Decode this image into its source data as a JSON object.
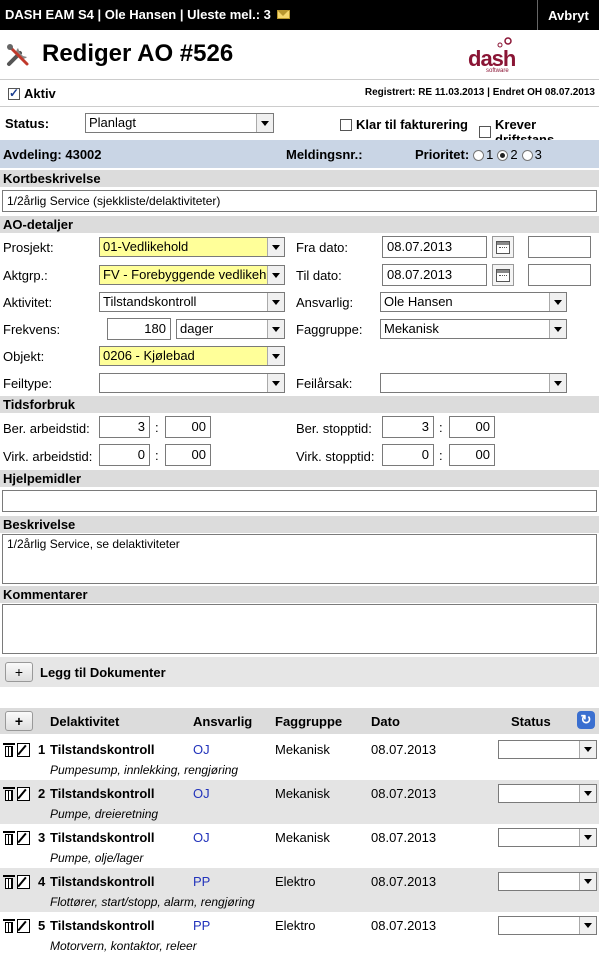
{
  "topbar": {
    "title": "DASH EAM S4 | Ole Hansen | Uleste mel.: 3",
    "cancel": "Avbryt"
  },
  "page": {
    "title": "Rediger AO #526",
    "logo_text": "dash",
    "logo_sub": "software"
  },
  "aktiv": {
    "label": "Aktiv",
    "checked": true
  },
  "registrert": "Registrert: RE 11.03.2013 | Endret OH 08.07.2013",
  "status": {
    "label": "Status:",
    "value": "Planlagt"
  },
  "klar": {
    "label": "Klar til fakturering",
    "checked": false
  },
  "krever": {
    "label": "Krever driftstans",
    "checked": false
  },
  "avdeling": "Avdeling: 43002",
  "meldingsnr": "Meldingsnr.:",
  "prioritet": {
    "label": "Prioritet:",
    "options": [
      "1",
      "2",
      "3"
    ],
    "selected": "2"
  },
  "kortbeskrivelse": {
    "label": "Kortbeskrivelse",
    "value": "1/2årlig Service (sjekkliste/delaktiviteter)"
  },
  "ao_detaljer": {
    "label": "AO-detaljer",
    "prosjekt": {
      "label": "Prosjekt:",
      "value": "01-Vedlikehold"
    },
    "aktgrp": {
      "label": "Aktgrp.:",
      "value": "FV - Forebyggende vedlikeh"
    },
    "aktivitet": {
      "label": "Aktivitet:",
      "value": "Tilstandskontroll"
    },
    "frekvens": {
      "label": "Frekvens:",
      "value": "180",
      "unit": "dager"
    },
    "objekt": {
      "label": "Objekt:",
      "value": "0206 - Kjølebad"
    },
    "feiltype": {
      "label": "Feiltype:",
      "value": ""
    },
    "fra_dato": {
      "label": "Fra dato:",
      "value": "08.07.2013",
      "time": ""
    },
    "til_dato": {
      "label": "Til dato:",
      "value": "08.07.2013",
      "time": ""
    },
    "ansvarlig": {
      "label": "Ansvarlig:",
      "value": "Ole Hansen"
    },
    "faggruppe": {
      "label": "Faggruppe:",
      "value": "Mekanisk"
    },
    "feilarsak": {
      "label": "Feilårsak:",
      "value": ""
    }
  },
  "tidsforbruk": {
    "label": "Tidsforbruk",
    "ber_arbeid": {
      "label": "Ber. arbeidstid:",
      "h": "3",
      "m": "00"
    },
    "virk_arbeid": {
      "label": "Virk. arbeidstid:",
      "h": "0",
      "m": "00"
    },
    "ber_stopp": {
      "label": "Ber. stopptid:",
      "h": "3",
      "m": "00"
    },
    "virk_stopp": {
      "label": "Virk. stopptid:",
      "h": "0",
      "m": "00"
    },
    "sep": ":"
  },
  "hjelpemidler": {
    "label": "Hjelpemidler",
    "value": ""
  },
  "beskrivelse": {
    "label": "Beskrivelse",
    "value": "1/2årlig Service, se delaktiviteter"
  },
  "kommentarer": {
    "label": "Kommentarer",
    "value": ""
  },
  "dokumenter": {
    "plus": "+",
    "label": "Legg til Dokumenter"
  },
  "table": {
    "plus": "+",
    "headers": {
      "delaktivitet": "Delaktivitet",
      "ansvarlig": "Ansvarlig",
      "faggruppe": "Faggruppe",
      "dato": "Dato",
      "status": "Status"
    },
    "rows": [
      {
        "num": "1",
        "name": "Tilstandskontroll",
        "desc": "Pumpesump, innlekking, rengjøring",
        "ans": "OJ",
        "fag": "Mekanisk",
        "dato": "08.07.2013",
        "status": ""
      },
      {
        "num": "2",
        "name": "Tilstandskontroll",
        "desc": "Pumpe, dreieretning",
        "ans": "OJ",
        "fag": "Mekanisk",
        "dato": "08.07.2013",
        "status": ""
      },
      {
        "num": "3",
        "name": "Tilstandskontroll",
        "desc": "Pumpe, olje/lager",
        "ans": "OJ",
        "fag": "Mekanisk",
        "dato": "08.07.2013",
        "status": ""
      },
      {
        "num": "4",
        "name": "Tilstandskontroll",
        "desc": "Flottører, start/stopp, alarm, rengjøring",
        "ans": "PP",
        "fag": "Elektro",
        "dato": "08.07.2013",
        "status": ""
      },
      {
        "num": "5",
        "name": "Tilstandskontroll",
        "desc": "Motorvern, kontaktor, releer",
        "ans": "PP",
        "fag": "Elektro",
        "dato": "08.07.2013",
        "status": ""
      }
    ]
  }
}
